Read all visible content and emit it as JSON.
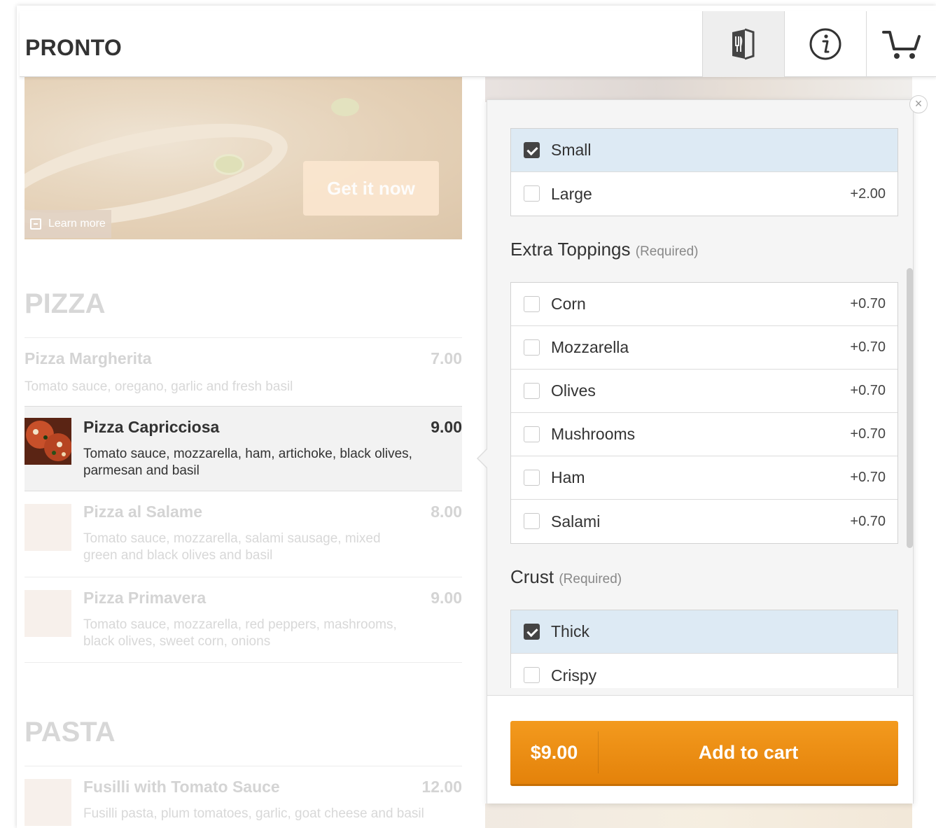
{
  "app": {
    "logo": "PRONTO"
  },
  "header": {
    "buttons": [
      {
        "icon": "menu-book-icon",
        "active": true
      },
      {
        "icon": "info-icon",
        "active": false
      },
      {
        "icon": "cart-icon",
        "active": false
      }
    ]
  },
  "hero": {
    "cta_label": "Get it now",
    "learn_more": "Learn more"
  },
  "sections": {
    "pizza": {
      "title": "PIZZA",
      "items": [
        {
          "name": "Pizza Margherita",
          "price": "7.00",
          "desc": "Tomato sauce, oregano, garlic and fresh basil"
        },
        {
          "name": "Pizza Capricciosa",
          "price": "9.00",
          "desc": "Tomato sauce, mozzarella, ham, artichoke, black olives, parmesan and basil"
        },
        {
          "name": "Pizza al Salame",
          "price": "8.00",
          "desc": "Tomato sauce, mozzarella, salami sausage, mixed green and black olives and basil"
        },
        {
          "name": "Pizza Primavera",
          "price": "9.00",
          "desc": "Tomato sauce, mozzarella, red peppers, mashrooms, black olives, sweet corn, onions"
        }
      ]
    },
    "pasta": {
      "title": "PASTA",
      "items": [
        {
          "name": "Fusilli with Tomato Sauce",
          "price": "12.00",
          "desc": "Fusilli pasta, plum tomatoes, garlic, goat cheese and basil"
        }
      ]
    }
  },
  "popover": {
    "size_options": [
      {
        "label": "Small",
        "price": "",
        "checked": true
      },
      {
        "label": "Large",
        "price": "+2.00",
        "checked": false
      }
    ],
    "toppings": {
      "title": "Extra Toppings",
      "required": "(Required)",
      "options": [
        {
          "label": "Corn",
          "price": "+0.70",
          "checked": false
        },
        {
          "label": "Mozzarella",
          "price": "+0.70",
          "checked": false
        },
        {
          "label": "Olives",
          "price": "+0.70",
          "checked": false
        },
        {
          "label": "Mushrooms",
          "price": "+0.70",
          "checked": false
        },
        {
          "label": "Ham",
          "price": "+0.70",
          "checked": false
        },
        {
          "label": "Salami",
          "price": "+0.70",
          "checked": false
        }
      ]
    },
    "crust": {
      "title": "Crust",
      "required": "(Required)",
      "options": [
        {
          "label": "Thick",
          "price": "",
          "checked": true
        },
        {
          "label": "Crispy",
          "price": "",
          "checked": false
        }
      ]
    },
    "close_label": "×",
    "add_to_cart": {
      "price": "$9.00",
      "label": "Add to cart"
    }
  },
  "colors": {
    "accent": "#f0941a",
    "selected_option_bg": "#ddeaf4"
  }
}
